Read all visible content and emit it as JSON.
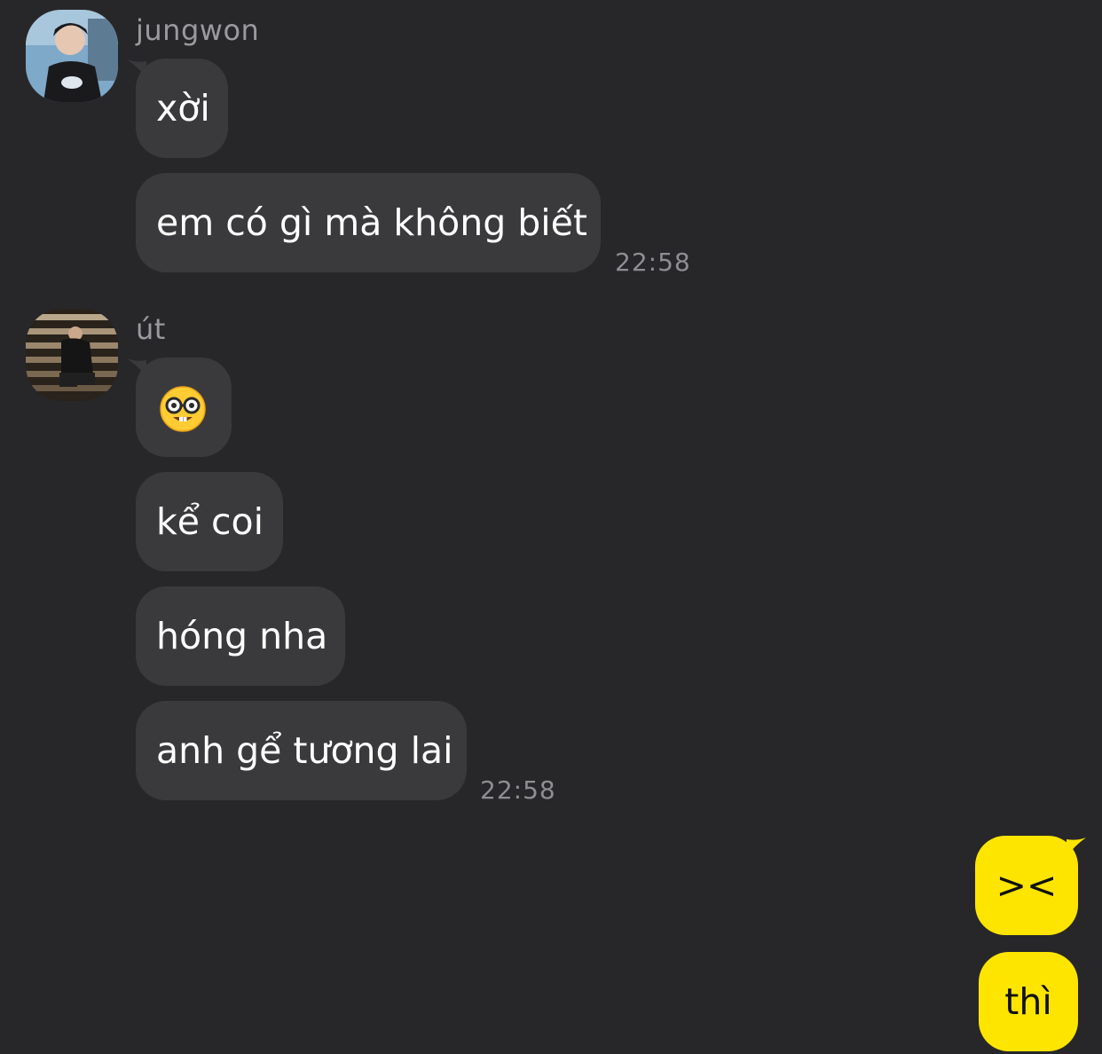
{
  "groups": [
    {
      "sender": "jungwon",
      "messages": [
        {
          "text": "xời"
        },
        {
          "text": "em có gì mà không biết"
        }
      ],
      "time": "22:58"
    },
    {
      "sender": "út",
      "messages": [
        {
          "icon": "nerd-face-emoji"
        },
        {
          "text": "kể coi"
        },
        {
          "text": "hóng nha"
        },
        {
          "text": "anh gể tương lai"
        }
      ],
      "time": "22:58"
    }
  ],
  "outgoing": [
    {
      "text": "><"
    },
    {
      "text": "thì"
    }
  ],
  "colors": {
    "background": "#272729",
    "incoming_bubble": "#3a3a3c",
    "outgoing_bubble": "#fee500",
    "name_text": "#9a9a9e",
    "timestamp_text": "#8e8e92"
  }
}
